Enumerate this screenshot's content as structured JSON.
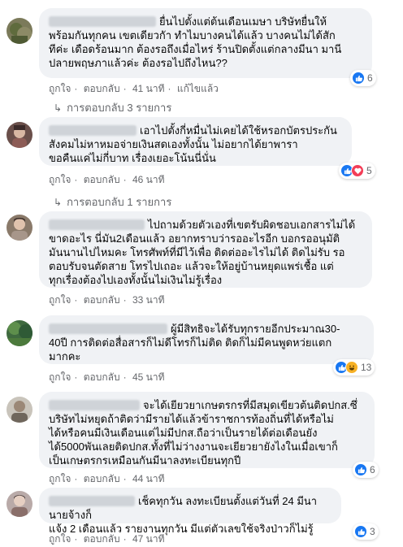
{
  "colors": {
    "bubble": "#f0f2f5",
    "meta_text": "#65676b",
    "like_blue": "#1877f2",
    "love_red": "#f33e58",
    "haha_yellow": "#f7b125"
  },
  "comments": [
    {
      "lines": [
        "ยื่นไปตั้งแต่ต้นเดือนเมษา บริษัทยื่นให้",
        "พร้อมกันทุกคน เขตเดียวกัา ทำไมบางคนได้แล้ว บางคนไม่ได้สัก",
        "ทีค่ะ เดือดร้อนมาก ต้องรอถึงเมื่อไหร่ ร้านปิดตั้งแต่กลางมีนา มานี",
        "ปลายพฤษภาแล้วค่ะ ต้องรอไปถึงไหน??"
      ],
      "like": "ถูกใจ",
      "reply": "ตอบกลับ",
      "time": "41 นาที",
      "edited": "แก้ไขแล้ว",
      "reaction_count": "6",
      "reaction_icons": [
        "like-icon"
      ],
      "replies_link": "การตอบกลับ 3 รายการ"
    },
    {
      "lines": [
        "เอาไปตั้งกี่หมื่นไม่เคยได้ใช้หรอกบัตรประกัน",
        "สังคมไม่หาหมอจ่ายเงินสดเองทั้งนั้น ไม่อยากได้ยาพารา",
        "ขอคืนแค่ไม่กี่บาท เรื่องเยอะโน้นนี่นั่น"
      ],
      "like": "ถูกใจ",
      "reply": "ตอบกลับ",
      "time": "46 นาที",
      "reaction_count": "5",
      "reaction_icons": [
        "like-icon",
        "love-icon"
      ],
      "replies_link": "การตอบกลับ 1 รายการ"
    },
    {
      "lines": [
        "ไปถามด้วยตัวเองที่เขตรับผิดชอบเอกสารไม่ได้",
        "ขาดอะไร นี่มัน2เดือนแล้ว อยากทราบว่ารออะไรอีก บอกรออนุมัติ",
        "มันนานไปไหมคะ โทรศัพท์ที่มีไว้เพื่อ ติดต่ออะไรไม่ได้ ติดไม่รับ รอ",
        "ตอบรับจนตัดสาย โทรไปเถอะ แล้วจะให้อยู่บ้านหยุดแพร่เชื้อ แต่",
        "ทุกเรื่องต้องไปเองทั้งนั้นไม่เงินไม่รู้เรื่อง"
      ],
      "like": "ถูกใจ",
      "reply": "ตอบกลับ",
      "time": "33 นาที"
    },
    {
      "lines": [
        "ผู้มีสิทธิจะได้รับทุกรายอีกประมาณ30-",
        "40ปี การติดต่อสื่อสารก็ไม่ดีโทรก็ไม่ติด ติดก็ไม่มีคนพูดหว่ยแตก",
        "มากคะ"
      ],
      "like": "ถูกใจ",
      "reply": "ตอบกลับ",
      "time": "45 นาที",
      "reaction_count": "13",
      "reaction_icons": [
        "like-icon",
        "haha-icon"
      ]
    },
    {
      "lines": [
        "จะได้เยียวยาเกษตรกรที่มีสมุดเขียวต้นติดปกส.ซึ่",
        "บริษัทไม่หยุดถ้าติดว่ามีรายได้แล้วข้าราชการท้องถิ่นที่ได้หรือไม่",
        "ได้หรือคนมีเงินเดือนแต่ไม่มีปกส.ถือว่าเป็นรายได้ต่อเดือนยัง",
        "ได้5000พันเลยติดปกส.ทั้งที่ไม่ว่างงานจะเยียวยายังไงในเมื่อเขาก็",
        "เป็นเกษตรกรเหมือนกันมีนาลงทะเบียนทุกปี"
      ],
      "like": "ถูกใจ",
      "reply": "ตอบกลับ",
      "time": "44 นาที",
      "reaction_count": "6",
      "reaction_icons": [
        "like-icon"
      ]
    },
    {
      "lines": [
        "เช็คทุกวัน ลงทะเบียนตั้งแต่วันที่ 24 มีนา นายจ้างก็",
        "แจ้ง 2 เดือนแล้ว รายงานทุกวัน มีแต่ตัวเลขใช้จริงป่าวก็ไม่รู้"
      ],
      "like": "ถูกใจ",
      "reply": "ตอบกลับ",
      "time": "47 นาที",
      "reaction_count": "3",
      "reaction_icons": [
        "like-icon"
      ]
    }
  ]
}
